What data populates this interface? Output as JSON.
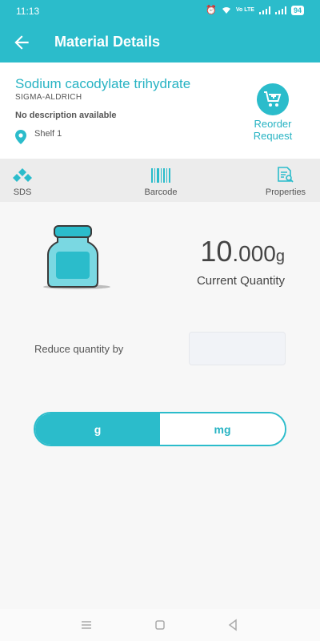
{
  "status_bar": {
    "time": "11:13",
    "network": "Vo LTE",
    "battery": "94"
  },
  "app_bar": {
    "title": "Material Details"
  },
  "material": {
    "name": "Sodium cacodylate trihydrate",
    "brand": "SIGMA-ALDRICH",
    "description": "No description available",
    "location": "Shelf 1"
  },
  "reorder": {
    "line1": "Reorder",
    "line2": "Request"
  },
  "tabs": [
    {
      "label": "SDS",
      "icon": "sds-icon"
    },
    {
      "label": "Barcode",
      "icon": "barcode-icon"
    },
    {
      "label": "Properties",
      "icon": "properties-icon"
    }
  ],
  "quantity": {
    "int": "10",
    "dec": ".000",
    "unit": "g",
    "caption": "Current Quantity"
  },
  "reduce": {
    "label": "Reduce quantity by",
    "value": ""
  },
  "unit_toggle": {
    "selected": "g",
    "options": [
      "g",
      "mg"
    ]
  },
  "colors": {
    "primary": "#2bbccb",
    "text": "#555555"
  }
}
